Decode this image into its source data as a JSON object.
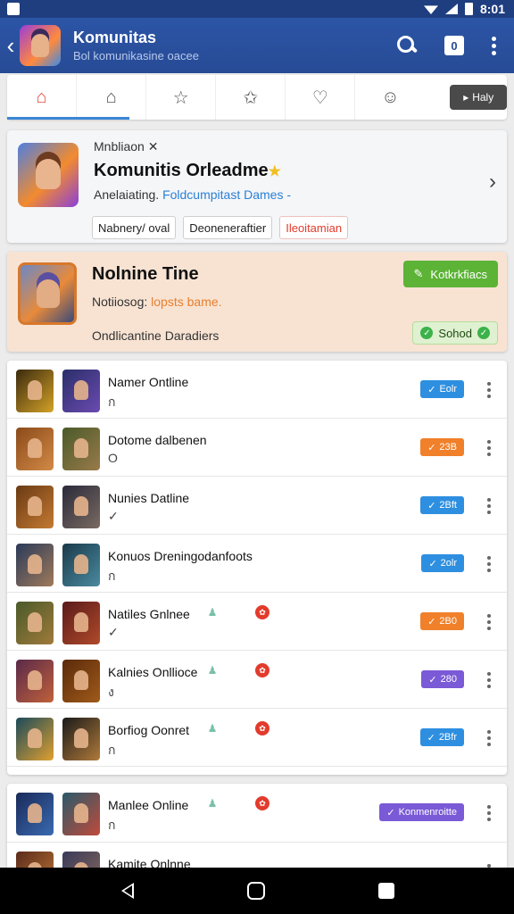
{
  "status_bar": {
    "time": "8:01"
  },
  "app_bar": {
    "title": "Komunitas",
    "subtitle": "Bol komunikasine oacee",
    "badge": "0"
  },
  "tabs": {
    "items": [
      "home-icon",
      "outline-home-icon",
      "star-icon",
      "star-outline-icon",
      "heart-icon",
      "smiley-icon"
    ],
    "dark_button": "Haly"
  },
  "featured": {
    "small_label": "Mnbliaon ✕",
    "title": "Komunitis Orleadme",
    "title_star": "★",
    "subtitle_prefix": "Anelaiating. ",
    "subtitle_accent": "Foldcumpitast Dames -",
    "chips": [
      "Nabnery/ oval",
      "Deoneneraftier",
      "Ileoitamian"
    ]
  },
  "highlight": {
    "title": "Nolnine Tine",
    "subtitle_prefix": "Notiiosog: ",
    "subtitle_accent": "lopsts bame.",
    "footer": "Ondlicantine Daradiers",
    "green_button": "Kotkrkfiacs",
    "status_badge": "Sohod"
  },
  "list_items": [
    {
      "name": "Namer Ontline",
      "sub": "ก",
      "pill": "Eolr",
      "pill_color": "#2e8fe0",
      "thumb_a": [
        "#3b2a0f",
        "#d4a227"
      ],
      "thumb_b": [
        "#2b2f6a",
        "#6a4ab0"
      ],
      "tag": ""
    },
    {
      "name": "Dotome dalbenen",
      "sub": "O",
      "pill": "23B",
      "pill_color": "#f0802a",
      "thumb_a": [
        "#8a4a1a",
        "#d28a46"
      ],
      "thumb_b": [
        "#4a5a2a",
        "#9a7a4a"
      ],
      "tag": ""
    },
    {
      "name": "Nunies Datline",
      "sub": "✓",
      "pill": "2Bft",
      "pill_color": "#2e8fe0",
      "thumb_a": [
        "#6a3a14",
        "#c47a32"
      ],
      "thumb_b": [
        "#2a2a3a",
        "#7a6a62"
      ],
      "tag": ""
    },
    {
      "name": "Konuos Dreningodanfoots",
      "sub": "ก",
      "pill": "2olr",
      "pill_color": "#2e8fe0",
      "thumb_a": [
        "#2a3a5a",
        "#a07a5a"
      ],
      "thumb_b": [
        "#1a3a4a",
        "#4a8aa0"
      ],
      "tag": ""
    },
    {
      "name": "Natiles Gnlnee",
      "sub": "✓",
      "pill": "2B0",
      "pill_color": "#f0802a",
      "thumb_a": [
        "#4a5a2a",
        "#a07a3a"
      ],
      "thumb_b": [
        "#5a1a1a",
        "#b04a2a"
      ],
      "tag": "♟"
    },
    {
      "name": "Kalnies Onllioce",
      "sub": "ง",
      "pill": "280",
      "pill_color": "#7a5ad6",
      "thumb_a": [
        "#5a2a4a",
        "#c0603a"
      ],
      "thumb_b": [
        "#5a2a0a",
        "#a05a1a"
      ],
      "tag": "♟"
    },
    {
      "name": "Borfiog Oonret",
      "sub": "ก",
      "pill": "2Bfr",
      "pill_color": "#2e8fe0",
      "thumb_a": [
        "#1a4a5a",
        "#e0a030"
      ],
      "thumb_b": [
        "#1a1a1a",
        "#b07a3a"
      ],
      "tag": "♟"
    }
  ],
  "list_items_2": [
    {
      "name": "Manlee Online",
      "sub": "ก",
      "pill": "Konmenroitte",
      "pill_color": "#7a5ad6",
      "thumb_a": [
        "#1a2a5a",
        "#3a6ab0"
      ],
      "thumb_b": [
        "#2a5a6a",
        "#c04a3a"
      ],
      "tag": "♟"
    },
    {
      "name": "Kamite Onlnne",
      "sub": "",
      "pill": "",
      "pill_color": "#2e8fe0",
      "thumb_a": [
        "#5a2a1a",
        "#c07a3a"
      ],
      "thumb_b": [
        "#3a3a5a",
        "#8a6a5a"
      ],
      "tag": ""
    }
  ],
  "colors": {
    "app_bar": "#274b95",
    "accent_blue": "#2e8fe0",
    "accent_orange": "#f0802a",
    "accent_purple": "#7a5ad6",
    "green": "#5cb336"
  }
}
